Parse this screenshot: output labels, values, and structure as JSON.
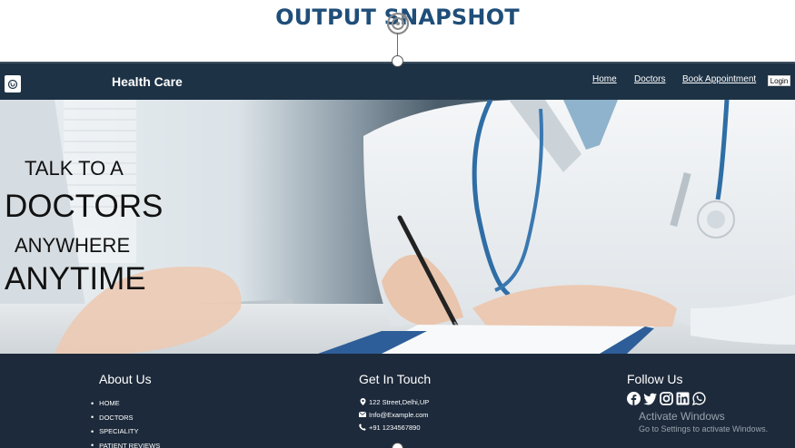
{
  "banner": {
    "title": "OUTPUT SNAPSHOT"
  },
  "nav": {
    "brand": "Health Care",
    "links": [
      "Home",
      "Doctors",
      "Book Appointment"
    ],
    "login": "Login"
  },
  "hero": {
    "lines": [
      "TALK TO A",
      "DOCTORS",
      "ANYWHERE",
      "ANYTIME"
    ]
  },
  "footer": {
    "about": {
      "heading": "About Us",
      "items": [
        "HOME",
        "DOCTORS",
        "SPECIALITY",
        "PATIENT REVIEWS"
      ]
    },
    "contact": {
      "heading": "Get In Touch",
      "address": "122 Street,Delhi,UP",
      "email": "Info@Example.com",
      "phone": "+91 1234567890"
    },
    "follow": {
      "heading": "Follow Us",
      "icons": [
        "facebook-icon",
        "twitter-icon",
        "instagram-icon",
        "linkedin-icon",
        "whatsapp-icon"
      ]
    }
  },
  "overlay": {
    "activate_title": "Activate Windows",
    "activate_sub": "Go to Settings to activate Windows."
  },
  "colors": {
    "banner_title": "#1f4e79",
    "navbar": "#1d3245",
    "footer": "#1d2a3b"
  }
}
